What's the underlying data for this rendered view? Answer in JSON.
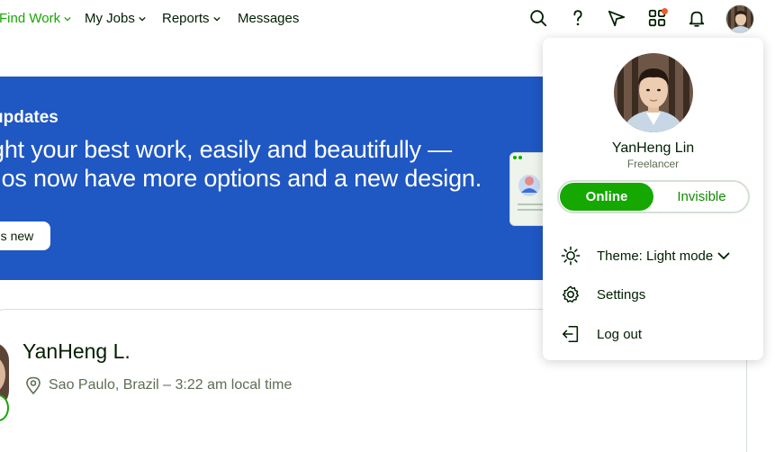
{
  "nav": {
    "items": [
      {
        "label": "Find Work",
        "active": true
      },
      {
        "label": "My Jobs",
        "active": false
      },
      {
        "label": "Reports",
        "active": false
      },
      {
        "label": "Messages",
        "active": false
      }
    ],
    "icons": [
      "search-icon",
      "help-icon",
      "send-icon",
      "apps-icon",
      "bell-icon"
    ],
    "notification_dot_color": "#f15b2a"
  },
  "banner": {
    "kicker": "updates",
    "line1": "ght your best work, easily and beautifully —",
    "line2": "lios now have more options and a new design.",
    "button_label": "'s new",
    "background": "#1f57c3"
  },
  "profile": {
    "name": "YanHeng L.",
    "location": "Sao Paulo, Brazil – 3:22 am local time"
  },
  "dropdown": {
    "name": "YanHeng Lin",
    "role": "Freelancer",
    "status_online": "Online",
    "status_invisible": "Invisible",
    "theme_label": "Theme: Light mode",
    "settings_label": "Settings",
    "logout_label": "Log out"
  },
  "colors": {
    "accent": "#14a800",
    "text": "#001e00"
  }
}
